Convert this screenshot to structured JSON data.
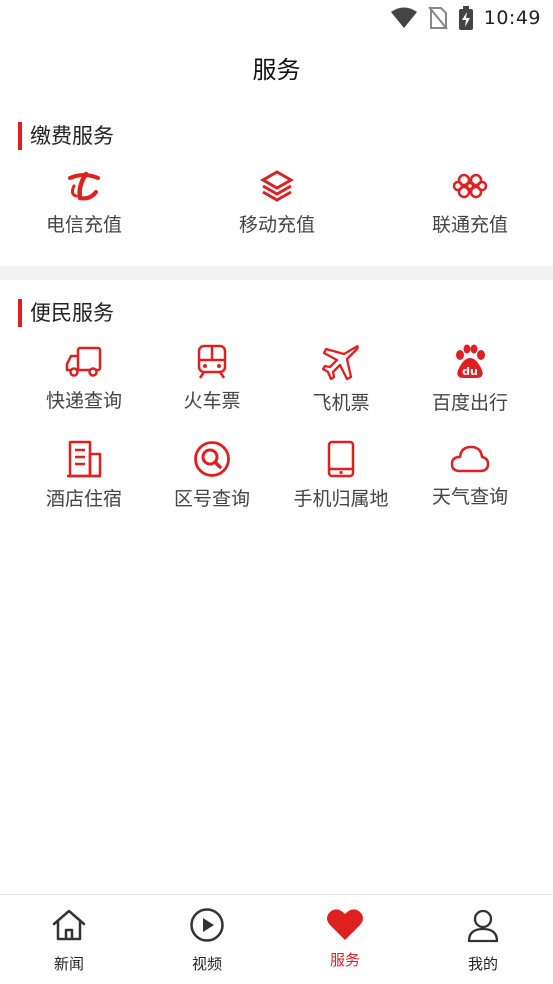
{
  "status_bar": {
    "time": "10:49",
    "icons": [
      "wifi-icon",
      "no-sim-icon",
      "battery-charging-icon"
    ]
  },
  "header": {
    "title": "服务"
  },
  "payment_section": {
    "title": "缴费服务",
    "items": [
      {
        "label": "电信充值",
        "icon": "china-telecom-icon"
      },
      {
        "label": "移动充值",
        "icon": "china-mobile-icon"
      },
      {
        "label": "联通充值",
        "icon": "china-unicom-icon"
      }
    ]
  },
  "convenience_section": {
    "title": "便民服务",
    "items": [
      {
        "label": "快递查询",
        "icon": "truck-icon"
      },
      {
        "label": "火车票",
        "icon": "train-icon"
      },
      {
        "label": "飞机票",
        "icon": "airplane-icon"
      },
      {
        "label": "百度出行",
        "icon": "baidu-paw-icon"
      },
      {
        "label": "酒店住宿",
        "icon": "hotel-icon"
      },
      {
        "label": "区号查询",
        "icon": "search-circle-icon"
      },
      {
        "label": "手机归属地",
        "icon": "phone-icon"
      },
      {
        "label": "天气查询",
        "icon": "cloud-icon"
      }
    ]
  },
  "tab_bar": {
    "tabs": [
      {
        "label": "新闻",
        "icon": "home-icon"
      },
      {
        "label": "视频",
        "icon": "play-circle-icon"
      },
      {
        "label": "服务",
        "icon": "heart-icon",
        "active": true
      },
      {
        "label": "我的",
        "icon": "user-icon"
      }
    ]
  },
  "colors": {
    "accent": "#e02020",
    "text": "#333333",
    "divider": "#f2f2f2"
  }
}
